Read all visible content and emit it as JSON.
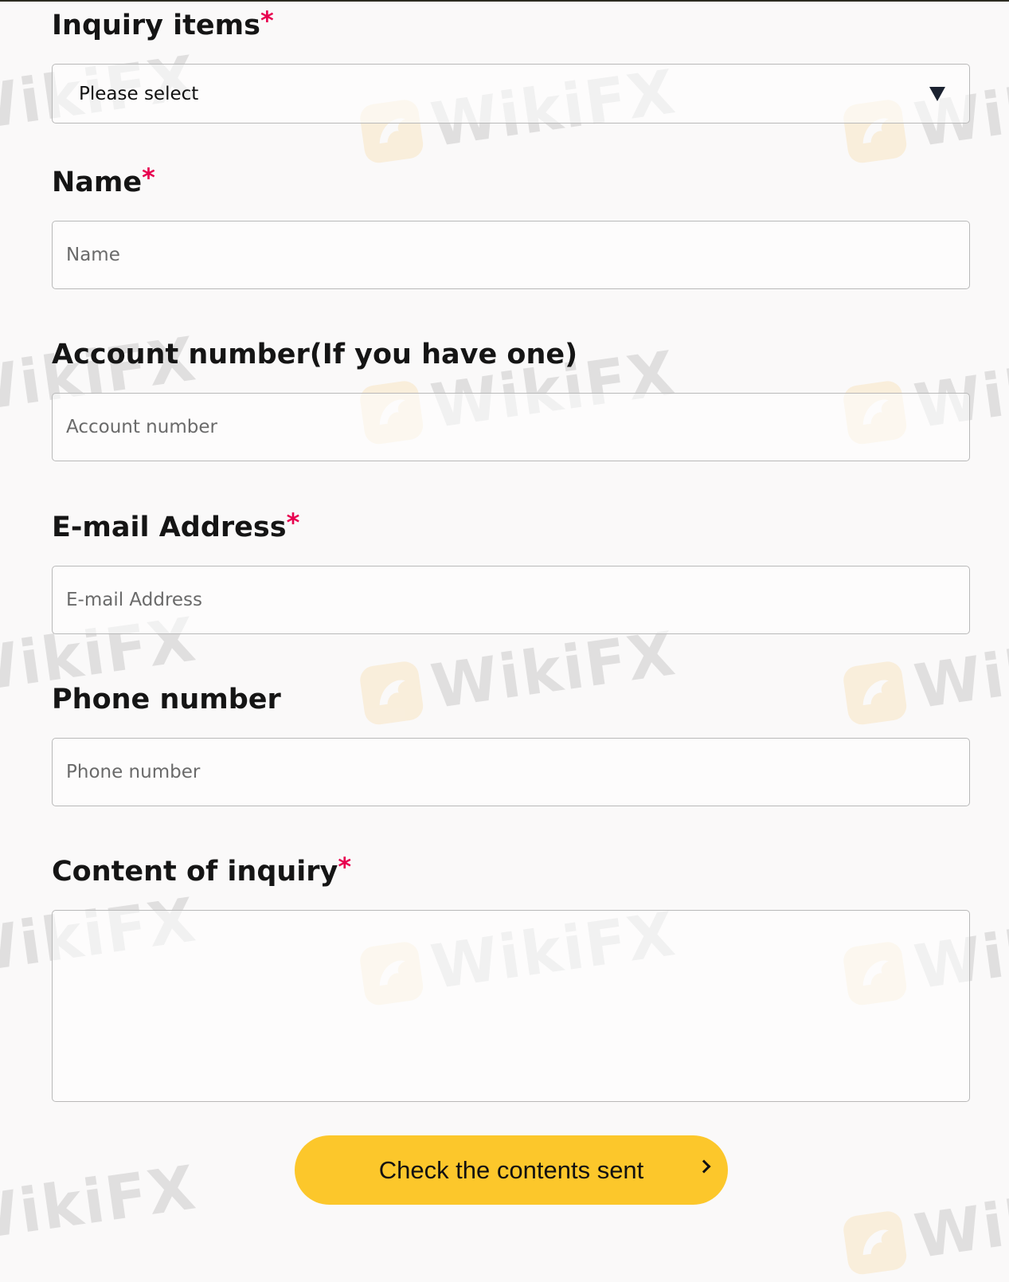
{
  "form": {
    "inquiry_items": {
      "label": "Inquiry items",
      "required_mark": "*",
      "selected_value": "Please select"
    },
    "name": {
      "label": "Name",
      "required_mark": "*",
      "placeholder": "Name"
    },
    "account_number": {
      "label": "Account number(If you have one)",
      "placeholder": "Account number"
    },
    "email": {
      "label": "E-mail Address",
      "required_mark": "*",
      "placeholder": "E-mail Address"
    },
    "phone": {
      "label": "Phone number",
      "placeholder": "Phone number"
    },
    "content": {
      "label": "Content of inquiry",
      "required_mark": "*",
      "value": ""
    },
    "submit": {
      "label": "Check the contents sent",
      "icon": "chevron-right-icon"
    }
  },
  "watermark": {
    "text": "WikiFX",
    "icon": "wikifx-logo-icon"
  },
  "colors": {
    "accent": "#fcc72b",
    "required": "#e8004f",
    "border": "#b9b9b9",
    "background": "#faf9f9"
  }
}
